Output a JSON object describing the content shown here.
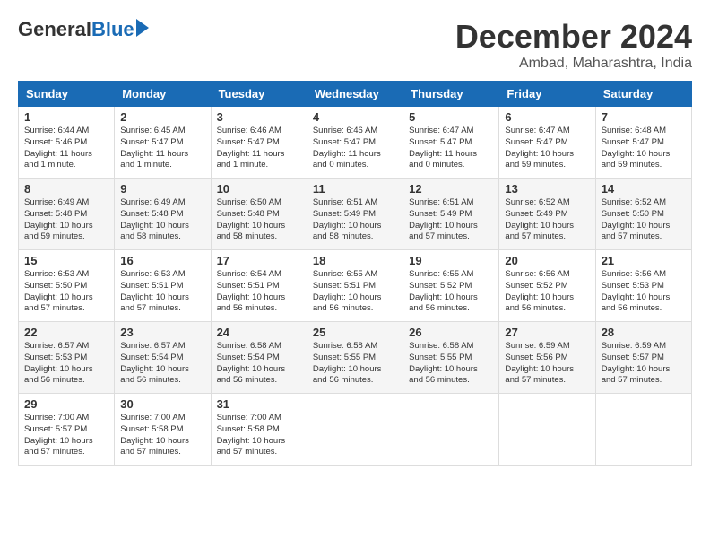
{
  "header": {
    "logo_general": "General",
    "logo_blue": "Blue",
    "month_title": "December 2024",
    "location": "Ambad, Maharashtra, India"
  },
  "weekdays": [
    "Sunday",
    "Monday",
    "Tuesday",
    "Wednesday",
    "Thursday",
    "Friday",
    "Saturday"
  ],
  "weeks": [
    [
      {
        "day": "1",
        "info": "Sunrise: 6:44 AM\nSunset: 5:46 PM\nDaylight: 11 hours and 1 minute."
      },
      {
        "day": "2",
        "info": "Sunrise: 6:45 AM\nSunset: 5:47 PM\nDaylight: 11 hours and 1 minute."
      },
      {
        "day": "3",
        "info": "Sunrise: 6:46 AM\nSunset: 5:47 PM\nDaylight: 11 hours and 1 minute."
      },
      {
        "day": "4",
        "info": "Sunrise: 6:46 AM\nSunset: 5:47 PM\nDaylight: 11 hours and 0 minutes."
      },
      {
        "day": "5",
        "info": "Sunrise: 6:47 AM\nSunset: 5:47 PM\nDaylight: 11 hours and 0 minutes."
      },
      {
        "day": "6",
        "info": "Sunrise: 6:47 AM\nSunset: 5:47 PM\nDaylight: 10 hours and 59 minutes."
      },
      {
        "day": "7",
        "info": "Sunrise: 6:48 AM\nSunset: 5:47 PM\nDaylight: 10 hours and 59 minutes."
      }
    ],
    [
      {
        "day": "8",
        "info": "Sunrise: 6:49 AM\nSunset: 5:48 PM\nDaylight: 10 hours and 59 minutes."
      },
      {
        "day": "9",
        "info": "Sunrise: 6:49 AM\nSunset: 5:48 PM\nDaylight: 10 hours and 58 minutes."
      },
      {
        "day": "10",
        "info": "Sunrise: 6:50 AM\nSunset: 5:48 PM\nDaylight: 10 hours and 58 minutes."
      },
      {
        "day": "11",
        "info": "Sunrise: 6:51 AM\nSunset: 5:49 PM\nDaylight: 10 hours and 58 minutes."
      },
      {
        "day": "12",
        "info": "Sunrise: 6:51 AM\nSunset: 5:49 PM\nDaylight: 10 hours and 57 minutes."
      },
      {
        "day": "13",
        "info": "Sunrise: 6:52 AM\nSunset: 5:49 PM\nDaylight: 10 hours and 57 minutes."
      },
      {
        "day": "14",
        "info": "Sunrise: 6:52 AM\nSunset: 5:50 PM\nDaylight: 10 hours and 57 minutes."
      }
    ],
    [
      {
        "day": "15",
        "info": "Sunrise: 6:53 AM\nSunset: 5:50 PM\nDaylight: 10 hours and 57 minutes."
      },
      {
        "day": "16",
        "info": "Sunrise: 6:53 AM\nSunset: 5:51 PM\nDaylight: 10 hours and 57 minutes."
      },
      {
        "day": "17",
        "info": "Sunrise: 6:54 AM\nSunset: 5:51 PM\nDaylight: 10 hours and 56 minutes."
      },
      {
        "day": "18",
        "info": "Sunrise: 6:55 AM\nSunset: 5:51 PM\nDaylight: 10 hours and 56 minutes."
      },
      {
        "day": "19",
        "info": "Sunrise: 6:55 AM\nSunset: 5:52 PM\nDaylight: 10 hours and 56 minutes."
      },
      {
        "day": "20",
        "info": "Sunrise: 6:56 AM\nSunset: 5:52 PM\nDaylight: 10 hours and 56 minutes."
      },
      {
        "day": "21",
        "info": "Sunrise: 6:56 AM\nSunset: 5:53 PM\nDaylight: 10 hours and 56 minutes."
      }
    ],
    [
      {
        "day": "22",
        "info": "Sunrise: 6:57 AM\nSunset: 5:53 PM\nDaylight: 10 hours and 56 minutes."
      },
      {
        "day": "23",
        "info": "Sunrise: 6:57 AM\nSunset: 5:54 PM\nDaylight: 10 hours and 56 minutes."
      },
      {
        "day": "24",
        "info": "Sunrise: 6:58 AM\nSunset: 5:54 PM\nDaylight: 10 hours and 56 minutes."
      },
      {
        "day": "25",
        "info": "Sunrise: 6:58 AM\nSunset: 5:55 PM\nDaylight: 10 hours and 56 minutes."
      },
      {
        "day": "26",
        "info": "Sunrise: 6:58 AM\nSunset: 5:55 PM\nDaylight: 10 hours and 56 minutes."
      },
      {
        "day": "27",
        "info": "Sunrise: 6:59 AM\nSunset: 5:56 PM\nDaylight: 10 hours and 57 minutes."
      },
      {
        "day": "28",
        "info": "Sunrise: 6:59 AM\nSunset: 5:57 PM\nDaylight: 10 hours and 57 minutes."
      }
    ],
    [
      {
        "day": "29",
        "info": "Sunrise: 7:00 AM\nSunset: 5:57 PM\nDaylight: 10 hours and 57 minutes."
      },
      {
        "day": "30",
        "info": "Sunrise: 7:00 AM\nSunset: 5:58 PM\nDaylight: 10 hours and 57 minutes."
      },
      {
        "day": "31",
        "info": "Sunrise: 7:00 AM\nSunset: 5:58 PM\nDaylight: 10 hours and 57 minutes."
      },
      null,
      null,
      null,
      null
    ]
  ]
}
